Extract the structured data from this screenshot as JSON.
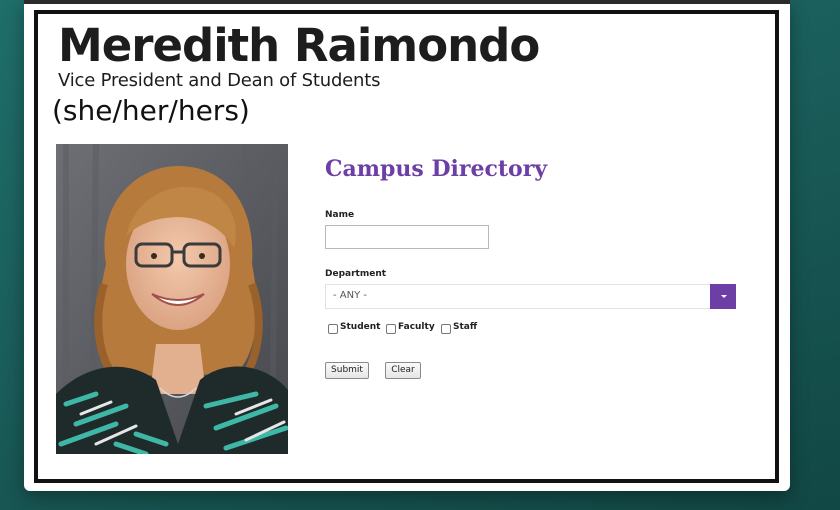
{
  "profile": {
    "name": "Meredith Raimondo",
    "title": "Vice President and Dean of Students",
    "pronouns": "(she/her/hers)"
  },
  "directory": {
    "heading": "Campus Directory",
    "name_label": "Name",
    "name_value": "",
    "department_label": "Department",
    "department_value": "- ANY -",
    "checkboxes": [
      {
        "label": "Student",
        "checked": false
      },
      {
        "label": "Faculty",
        "checked": false
      },
      {
        "label": "Staff",
        "checked": false
      }
    ],
    "submit_label": "Submit",
    "clear_label": "Clear"
  },
  "colors": {
    "accent": "#6d3fa6",
    "background": "#1a5d5a"
  }
}
